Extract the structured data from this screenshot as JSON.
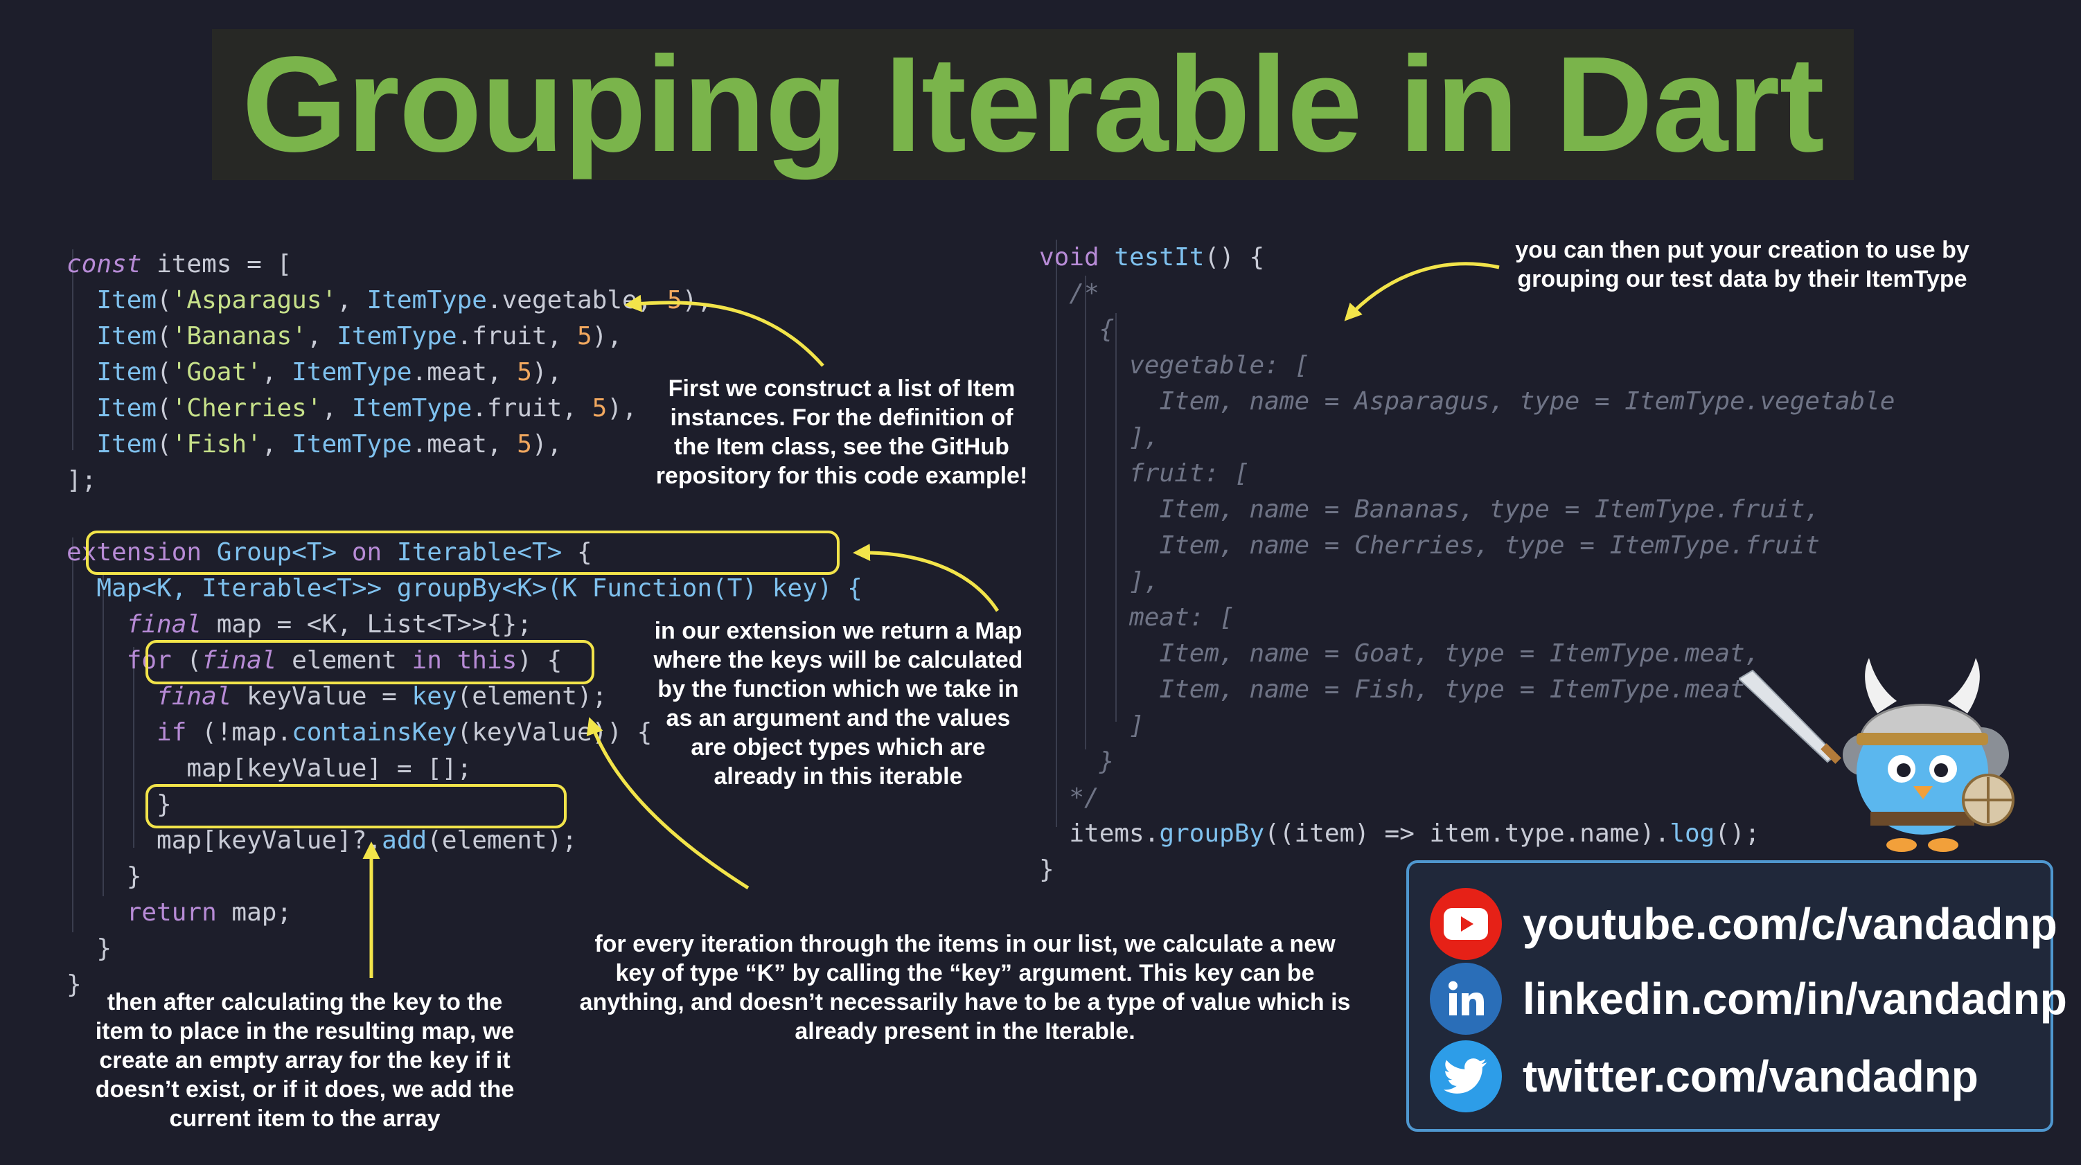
{
  "title": "Grouping Iterable in Dart",
  "code_left": {
    "l1": [
      "const",
      " items = ["
    ],
    "items": [
      {
        "fn": "Item",
        "str": "'Asparagus'",
        "type": "ItemType",
        "member": ".vegetable",
        "num": "5"
      },
      {
        "fn": "Item",
        "str": "'Bananas'",
        "type": "ItemType",
        "member": ".fruit",
        "num": "5"
      },
      {
        "fn": "Item",
        "str": "'Goat'",
        "type": "ItemType",
        "member": ".meat",
        "num": "5"
      },
      {
        "fn": "Item",
        "str": "'Cherries'",
        "type": "ItemType",
        "member": ".fruit",
        "num": "5"
      },
      {
        "fn": "Item",
        "str": "'Fish'",
        "type": "ItemType",
        "member": ".meat",
        "num": "5"
      }
    ],
    "close_list": "];",
    "ext_kw": "extension",
    "ext_name": "Group<T>",
    "ext_on": "on",
    "ext_type": "Iterable<T>",
    "ext_brace": " {",
    "sig_ret": "Map<K, Iterable<T>>",
    "sig_name": "groupBy<K>",
    "sig_args": "(K Function(T) key) {",
    "final_kw": "final",
    "map_decl": " map = <K, List<T>>{};",
    "for_kw": "for",
    "for_paren": " (",
    "for_final": "final",
    "for_elem": " element ",
    "for_in": "in",
    "for_this": "this",
    "for_end": ") {",
    "kv_final": "final",
    "kv_rest": " keyValue = ",
    "kv_key": "key",
    "kv_arg": "(element);",
    "if_kw": "if",
    "if_rest": " (!map.",
    "if_fn": "containsKey",
    "if_end": "(keyValue)) {",
    "assign": "map[keyValue] = [];",
    "close_brace": "}",
    "add_pre": "map[keyValue]?.",
    "add_fn": "add",
    "add_end": "(element);",
    "return_kw": "return",
    "return_rest": " map;"
  },
  "code_right": {
    "void_kw": "void",
    "fn_name": "testIt",
    "fn_rest": "() {",
    "cm_open": "/*",
    "cm_brace_open": "{",
    "cm_veg": "vegetable: [",
    "cm_veg1": "Item, name = Asparagus, type = ItemType.vegetable",
    "cm_close_list": "],",
    "cm_fruit": "fruit: [",
    "cm_fruit1": "Item, name = Bananas, type = ItemType.fruit,",
    "cm_fruit2": "Item, name = Cherries, type = ItemType.fruit",
    "cm_meat": "meat: [",
    "cm_meat1": "Item, name = Goat, type = ItemType.meat,",
    "cm_meat2": "Item, name = Fish, type = ItemType.meat",
    "cm_close_bracket": "]",
    "cm_brace_close": "}",
    "cm_end": "*/",
    "call_pre": "items.",
    "call_fn": "groupBy",
    "call_args": "((item) => item.type.name).",
    "call_log": "log",
    "call_end": "();",
    "close": "}"
  },
  "notes": {
    "n1": [
      "First we construct a list of Item",
      "instances. For the definition of",
      "the Item class, see the GitHub",
      "repository for this code example!"
    ],
    "n2": [
      "you can then put your creation to use by",
      "grouping our test data by their ItemType"
    ],
    "n3": [
      "in our extension we return a Map",
      "where the keys will be calculated",
      "by the function which we take in",
      "as an argument and the values",
      "are object types which are",
      "already in this iterable"
    ],
    "n4": [
      "for every iteration through the items in our list, we calculate a new",
      "key of type “K” by calling the “key” argument. This key can be",
      "anything, and doesn’t necessarily have to be a type of value which is",
      "already present in the Iterable."
    ],
    "n5": [
      "then after calculating the key to the",
      "item to place in the resulting map, we",
      "create an empty array for the key if it",
      "doesn’t exist, or if it does, we add the",
      "current item to the array"
    ]
  },
  "social": [
    {
      "label": "youtube.com/c/vandadnp",
      "icon": "youtube-icon",
      "color": "#e62117"
    },
    {
      "label": "linkedin.com/in/vandadnp",
      "icon": "linkedin-icon",
      "color": "#2a6eb8"
    },
    {
      "label": "twitter.com/vandadnp",
      "icon": "twitter-icon",
      "color": "#2d9de8"
    }
  ],
  "colors": {
    "title": "#7ab44b",
    "highlight": "#f2e44a",
    "background": "#1d1e2b"
  }
}
